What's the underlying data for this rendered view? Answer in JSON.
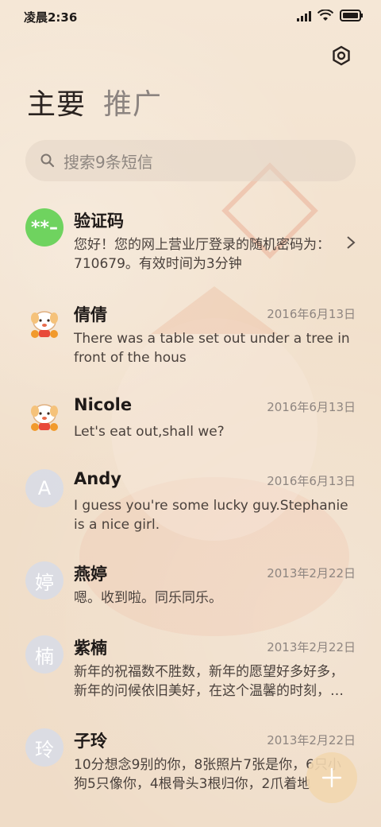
{
  "status_bar": {
    "time": "凌晨2:36"
  },
  "tabs": [
    {
      "label": "主要"
    },
    {
      "label": "推广"
    }
  ],
  "search": {
    "placeholder": "搜索9条短信"
  },
  "messages": [
    {
      "name": "验证码",
      "avatar_text": "**–",
      "date": "",
      "preview": "您好！您的网上营业厅登录的随机密码为：710679。有效时间为3分钟"
    },
    {
      "name": "倩倩",
      "avatar_icon": "sheep-mascot-icon",
      "date": "2016年6月13日",
      "preview": "There was a table set out under a tree in front of the hous"
    },
    {
      "name": "Nicole",
      "avatar_icon": "sheep-mascot-icon",
      "date": "2016年6月13日",
      "preview": "Let's eat out,shall we?"
    },
    {
      "name": "Andy",
      "avatar_text": "A",
      "date": "2016年6月13日",
      "preview": "I guess you're some lucky guy.Stephanie is a nice girl."
    },
    {
      "name": "燕婷",
      "avatar_text": "婷",
      "date": "2013年2月22日",
      "preview": "嗯。收到啦。同乐同乐。"
    },
    {
      "name": "紫楠",
      "avatar_text": "楠",
      "date": "2013年2月22日",
      "preview": "新年的祝福数不胜数，新年的愿望好多好多，新年的问候依旧美好，在这个温馨的时刻，…"
    },
    {
      "name": "子玲",
      "avatar_text": "玲",
      "date": "2013年2月22日",
      "preview": "10分想念9别的你，8张照片7张是你，6只小狗5只像你，4根骨头3根归你，2爪着地"
    }
  ],
  "colors": {
    "accent_green": "#6fd35f",
    "fab": "#f2d7af"
  }
}
